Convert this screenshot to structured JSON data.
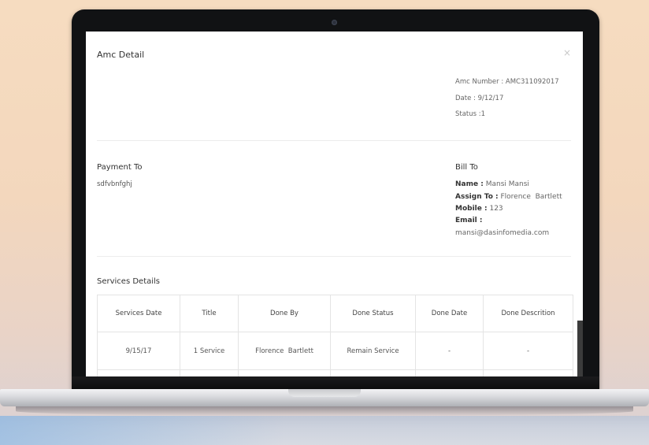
{
  "modal": {
    "title": "Amc Detail",
    "close_symbol": "×",
    "amc_number": "Amc Number : AMC311092017",
    "date": "Date : 9/12/17",
    "status": "Status :1"
  },
  "payment_to": {
    "heading": "Payment To",
    "value": "sdfvbnfghj"
  },
  "bill_to": {
    "heading": "Bill To",
    "name_label": "Name :",
    "name_value": "Mansi Mansi",
    "assign_label": "Assign To :",
    "assign_value": "Florence  Bartlett",
    "mobile_label": "Mobile :",
    "mobile_value": "123",
    "email_label": "Email :",
    "email_value": "mansi@dasinfomedia.com"
  },
  "services": {
    "heading": "Services Details",
    "columns": [
      "Services Date",
      "Title",
      "Done By",
      "Done Status",
      "Done Date",
      "Done Descrition"
    ],
    "rows": [
      [
        "9/15/17",
        "1 Service",
        "Florence  Bartlett",
        "Remain Service",
        "-",
        "-"
      ]
    ]
  },
  "icons": {
    "close": "close-icon",
    "camera": "camera-icon"
  }
}
